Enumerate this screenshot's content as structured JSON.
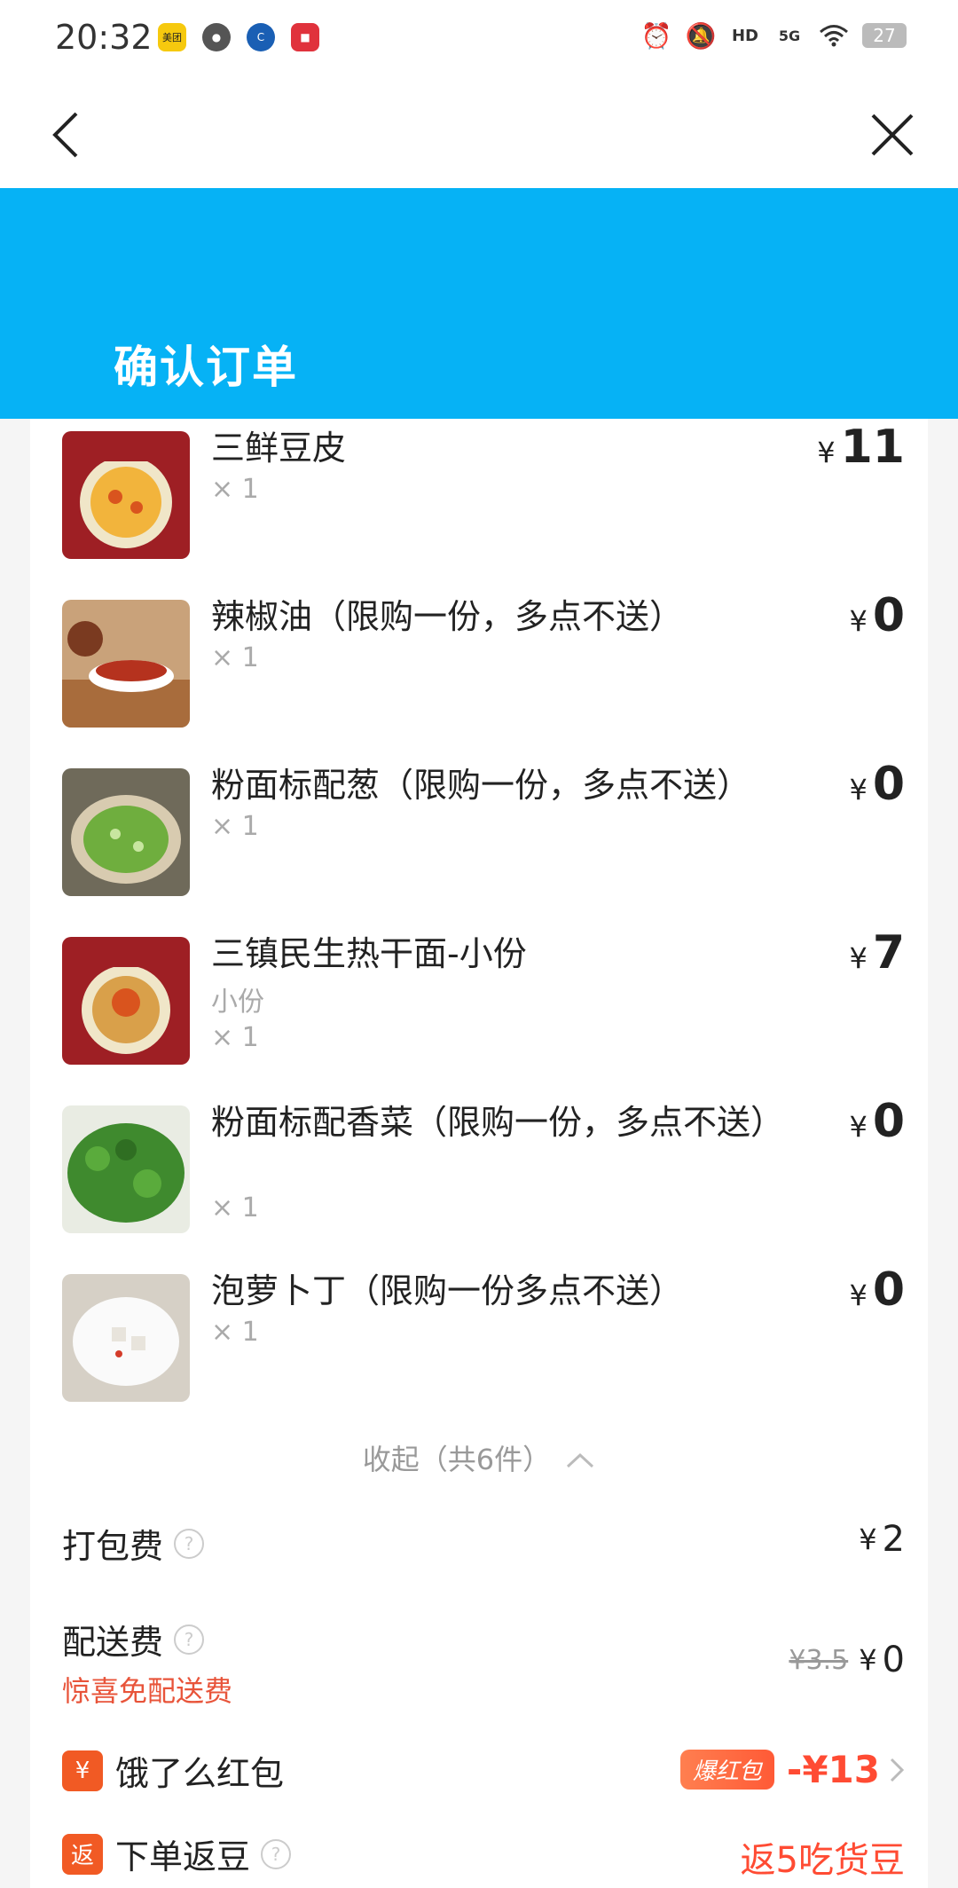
{
  "status": {
    "time": "20:32",
    "battery": "27",
    "network": "5G"
  },
  "header": {
    "title": "确认订单"
  },
  "colors": {
    "banner": "#06b2f5",
    "accent_red": "#ff4b33",
    "hint_red": "#e8543a"
  },
  "items": [
    {
      "name": "三鲜豆皮",
      "meta": [
        "× 1"
      ],
      "currency": "¥",
      "price": "11",
      "image": "sanxian-doupi-image"
    },
    {
      "name": "辣椒油（限购一份，多点不送）",
      "meta": [
        "× 1"
      ],
      "currency": "¥",
      "price": "0",
      "image": "chili-oil-image"
    },
    {
      "name": "粉面标配葱（限购一份，多点不送）",
      "meta": [
        "× 1"
      ],
      "currency": "¥",
      "price": "0",
      "image": "scallion-image"
    },
    {
      "name": "三镇民生热干面-小份",
      "meta": [
        "小份",
        "× 1"
      ],
      "currency": "¥",
      "price": "7",
      "image": "hot-dry-noodle-image"
    },
    {
      "name": "粉面标配香菜（限购一份，多点不送）",
      "meta": [
        "× 1"
      ],
      "currency": "¥",
      "price": "0",
      "image": "coriander-image"
    },
    {
      "name": "泡萝卜丁（限购一份多点不送）",
      "meta": [
        "× 1"
      ],
      "currency": "¥",
      "price": "0",
      "image": "pickled-radish-image"
    }
  ],
  "collapse": {
    "label": "收起（共6件）"
  },
  "fees": {
    "packing": {
      "label": "打包费",
      "currency": "¥",
      "value": "2"
    },
    "delivery": {
      "label": "配送费",
      "promo": "惊喜免配送费",
      "original": "¥3.5",
      "currency": "¥",
      "value": "0"
    },
    "red_packet": {
      "icon": "¥",
      "label": "饿了么红包",
      "tag": "爆红包",
      "amount": "-¥13"
    },
    "beans": {
      "icon": "返",
      "label": "下单返豆",
      "value": "返5吃货豆"
    }
  }
}
